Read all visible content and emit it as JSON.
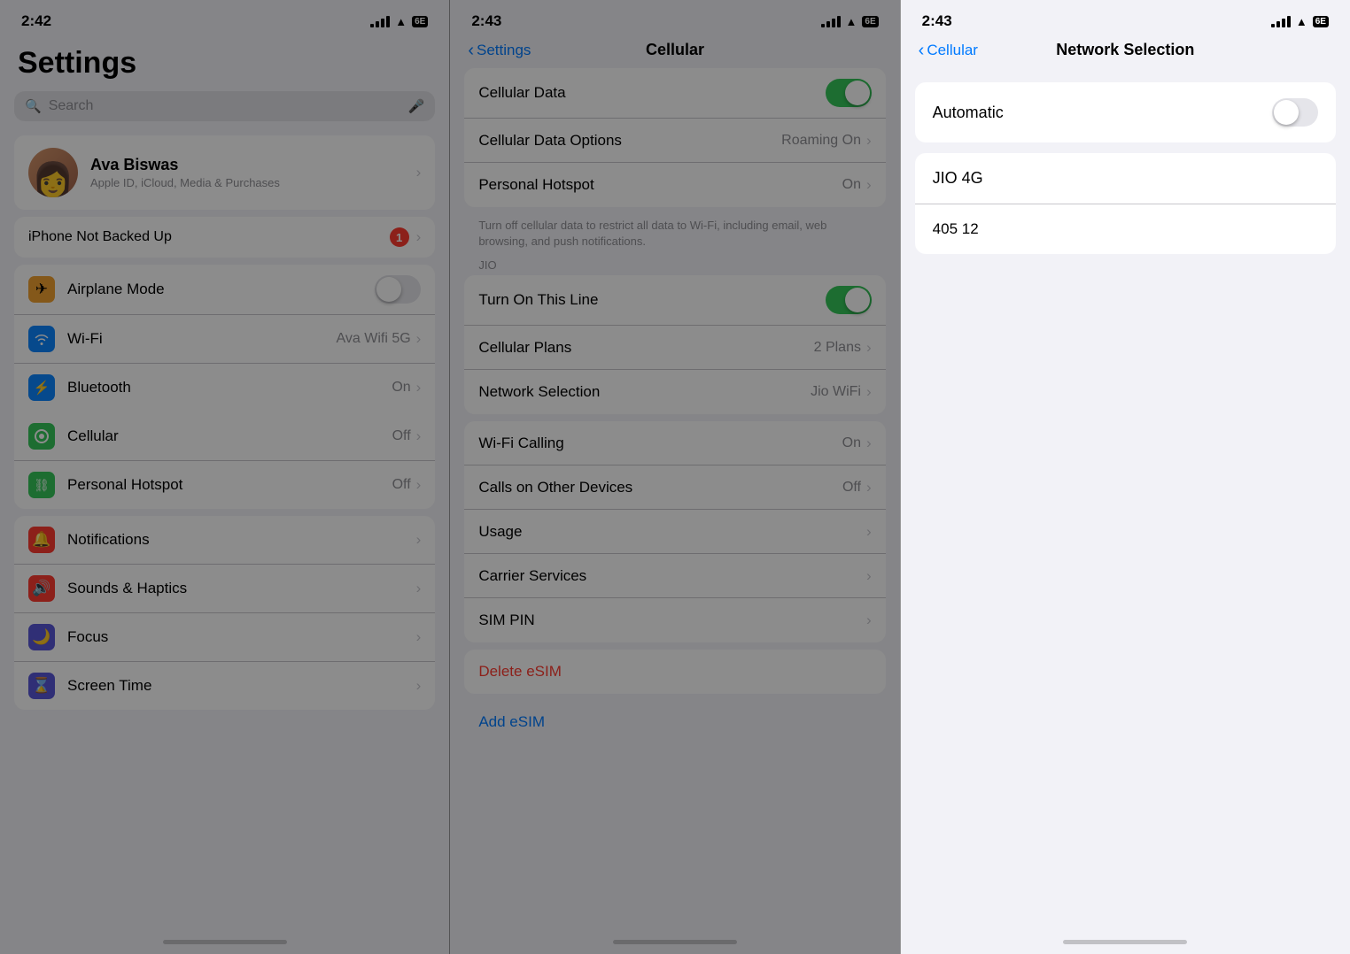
{
  "panel1": {
    "status": {
      "time": "2:42",
      "network_badge": "6E"
    },
    "title": "Settings",
    "search_placeholder": "Search",
    "profile": {
      "name": "Ava Biswas",
      "subtitle": "Apple ID, iCloud, Media & Purchases"
    },
    "backup_warning": "iPhone Not Backed Up",
    "backup_badge": "1",
    "items": [
      {
        "label": "Airplane Mode",
        "icon_bg": "#f0a030",
        "icon": "✈",
        "value": "",
        "type": "toggle",
        "toggle_state": "off"
      },
      {
        "label": "Wi-Fi",
        "icon_bg": "#0a84ff",
        "icon": "📶",
        "value": "Ava Wifi 5G",
        "type": "chevron"
      },
      {
        "label": "Bluetooth",
        "icon_bg": "#0a84ff",
        "icon": "🔷",
        "value": "On",
        "type": "chevron"
      },
      {
        "label": "Cellular",
        "icon_bg": "#34c759",
        "icon": "📡",
        "value": "Off",
        "type": "chevron",
        "highlighted": true
      },
      {
        "label": "Personal Hotspot",
        "icon_bg": "#34c759",
        "icon": "🔗",
        "value": "Off",
        "type": "chevron"
      }
    ],
    "section2": [
      {
        "label": "Notifications",
        "icon_bg": "#ff3b30",
        "icon": "🔔",
        "value": "",
        "type": "chevron"
      },
      {
        "label": "Sounds & Haptics",
        "icon_bg": "#ff3b30",
        "icon": "🔊",
        "value": "",
        "type": "chevron"
      },
      {
        "label": "Focus",
        "icon_bg": "#5856d6",
        "icon": "🌙",
        "value": "",
        "type": "chevron"
      },
      {
        "label": "Screen Time",
        "icon_bg": "#5856d6",
        "icon": "⌛",
        "value": "",
        "type": "chevron"
      }
    ]
  },
  "panel2": {
    "status": {
      "time": "2:43",
      "network_badge": "6E"
    },
    "nav_back": "Settings",
    "nav_title": "Cellular",
    "items": [
      {
        "label": "Cellular Data",
        "type": "toggle",
        "toggle_state": "on",
        "value": ""
      },
      {
        "label": "Cellular Data Options",
        "type": "chevron",
        "value": "Roaming On"
      },
      {
        "label": "Personal Hotspot",
        "type": "chevron",
        "value": "On"
      }
    ],
    "note": "Turn off cellular data to restrict all data to Wi-Fi, including email, web browsing, and push notifications.",
    "carrier": "JIO",
    "jio_items": [
      {
        "label": "Turn On This Line",
        "type": "toggle",
        "toggle_state": "on",
        "value": ""
      },
      {
        "label": "Cellular Plans",
        "type": "chevron",
        "value": "2 Plans"
      },
      {
        "label": "Network Selection",
        "type": "chevron",
        "value": "Jio WiFi",
        "highlighted": true
      }
    ],
    "items2": [
      {
        "label": "Wi-Fi Calling",
        "type": "chevron",
        "value": "On"
      },
      {
        "label": "Calls on Other Devices",
        "type": "chevron",
        "value": "Off"
      },
      {
        "label": "Usage",
        "type": "chevron",
        "value": ""
      },
      {
        "label": "Carrier Services",
        "type": "chevron",
        "value": ""
      },
      {
        "label": "SIM PIN",
        "type": "chevron",
        "value": ""
      }
    ],
    "delete_esim": "Delete eSIM",
    "add_esim": "Add eSIM"
  },
  "panel3": {
    "status": {
      "time": "2:43",
      "network_badge": "6E"
    },
    "nav_back": "Cellular",
    "nav_title": "Network Selection",
    "automatic_label": "Automatic",
    "toggle_state": "off",
    "network_selected": "JIO 4G",
    "network_code": "405 12"
  }
}
